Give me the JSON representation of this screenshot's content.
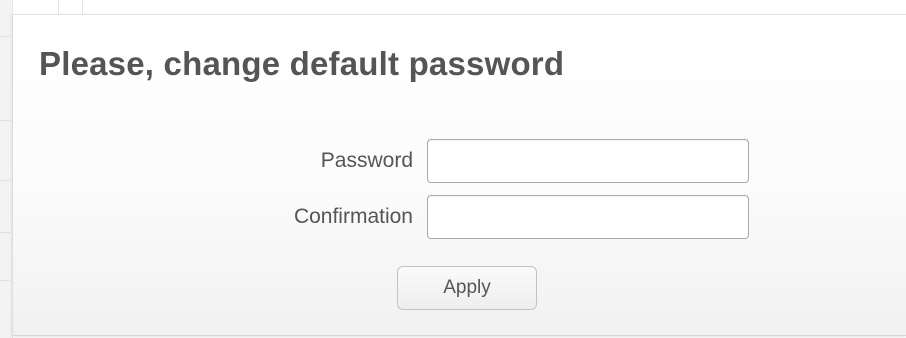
{
  "dialog": {
    "title": "Please, change default password",
    "fields": {
      "password": {
        "label": "Password",
        "value": "",
        "placeholder": ""
      },
      "confirmation": {
        "label": "Confirmation",
        "value": "",
        "placeholder": ""
      }
    },
    "apply_label": "Apply"
  },
  "colors": {
    "title_text": "#555555",
    "label_text": "#555555",
    "field_border": "#a9a9a9",
    "button_border": "#c2c2c2"
  }
}
